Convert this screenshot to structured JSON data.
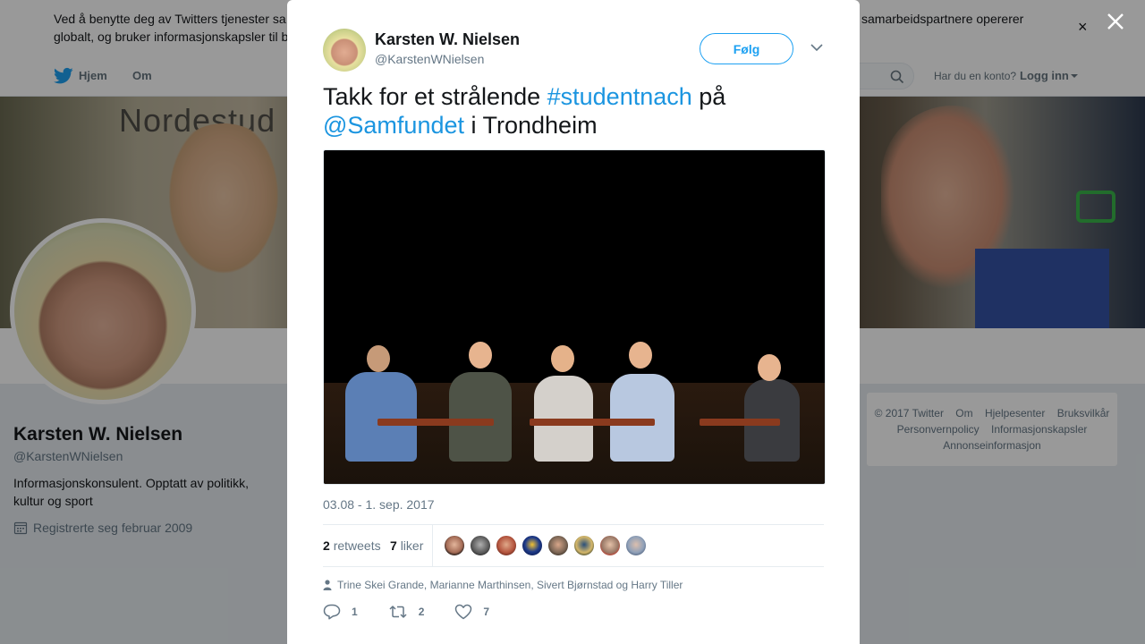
{
  "cookie": {
    "line1": "Ved å benytte deg av Twitters tjenester sa",
    "line2": "globalt, og bruker informasjonskapsler til b",
    "line3": "samarbeidspartnere opererer"
  },
  "nav": {
    "home_label": "Hjem",
    "about_label": "Om",
    "account_question": "Har du en konto?",
    "login_label": "Logg inn"
  },
  "banner": {
    "text": "Nordestud"
  },
  "profile": {
    "name": "Karsten W. Nielsen",
    "handle": "@KarstenWNielsen",
    "bio": "Informasjonskonsulent. Opptatt av politikk, kultur og sport",
    "joined": "Registrerte seg februar 2009"
  },
  "footer": {
    "links": [
      "© 2017 Twitter",
      "Om",
      "Hjelpesenter",
      "Bruksvilkår",
      "Personvernpolicy",
      "Informasjonskapsler",
      "Annonseinformasjon"
    ]
  },
  "tweet": {
    "author_name": "Karsten W. Nielsen",
    "author_handle": "@KarstenWNielsen",
    "follow_label": "Følg",
    "text_part1": "Takk for et strålende ",
    "hashtag": "#studentnach",
    "text_part2": " på",
    "mention": "@Samfundet",
    "text_part3": " i Trondheim",
    "date": "03.08 - 1. sep. 2017",
    "retweets_count": "2",
    "retweets_label": "retweets",
    "likes_count": "7",
    "likes_label": "liker",
    "tagged_people": "Trine Skei Grande, Marianne Marthinsen, Sivert Bjørnstad og Harry Tiller",
    "reply_count": "1",
    "retweet_count_action": "2",
    "like_count_action": "7"
  },
  "colors": {
    "accent": "#1da1f2",
    "link": "#1b95e0",
    "muted": "#657786"
  }
}
